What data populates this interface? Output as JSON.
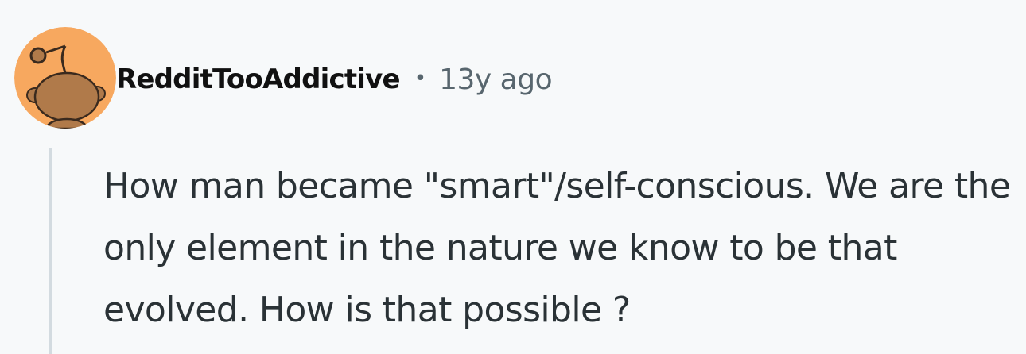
{
  "comment": {
    "author": "RedditTooAddictive",
    "separator": "•",
    "timestamp": "13y ago",
    "avatar_icon": "snoo-avatar-icon",
    "avatar_color": "#f7a85f",
    "body": "How man became \"smart\"/self-conscious. We are the only element in the nature we know to be that evolved. How is that possible ?"
  }
}
